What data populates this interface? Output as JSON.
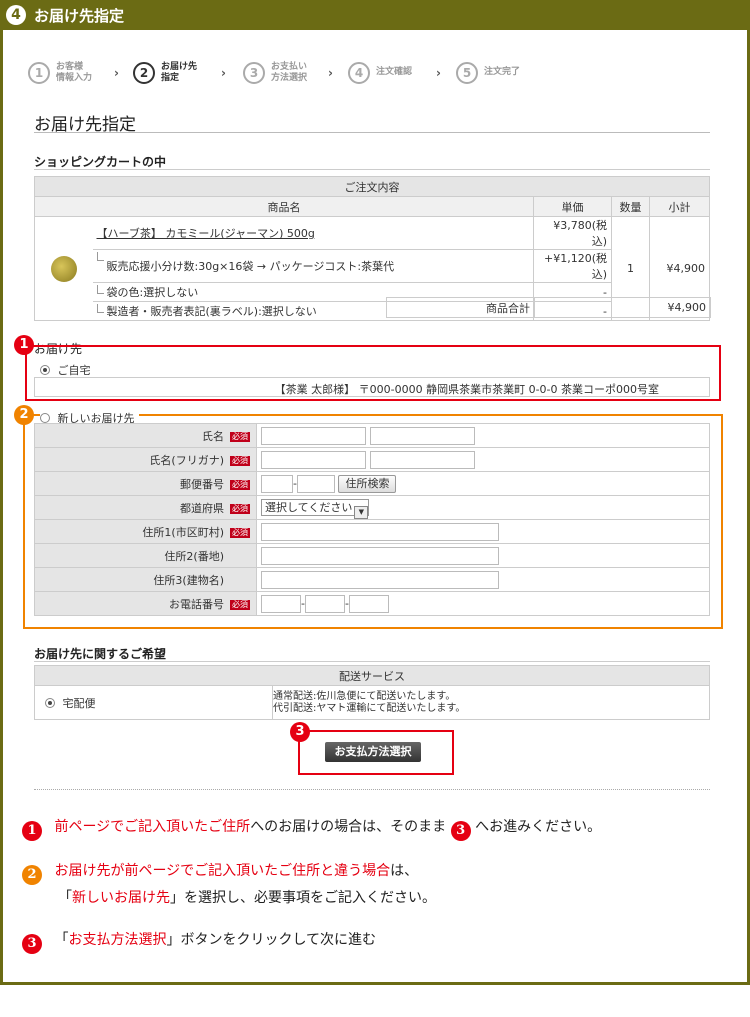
{
  "header": {
    "number": "4",
    "title": "お届け先指定"
  },
  "steps": [
    {
      "num": "1",
      "label1": "お客様",
      "label2": "情報入力"
    },
    {
      "num": "2",
      "label1": "お届け先",
      "label2": "指定"
    },
    {
      "num": "3",
      "label1": "お支払い",
      "label2": "方法選択"
    },
    {
      "num": "4",
      "label1": "注文確認",
      "label2": ""
    },
    {
      "num": "5",
      "label1": "注文完了",
      "label2": ""
    }
  ],
  "step_arrow": "›",
  "page_title": "お届け先指定",
  "cart": {
    "heading": "ショッピングカートの中",
    "table_title": "ご注文内容",
    "col_name": "商品名",
    "col_price": "単価",
    "col_qty": "数量",
    "col_subtotal": "小計",
    "product_name": "【ハーブ茶】 カモミール(ジャーマン) 500g",
    "product_price": "¥3,780(税込)",
    "qty": "1",
    "subtotal": "¥4,900",
    "options": [
      {
        "text": "販売応援小分け数:30g×16袋 → パッケージコスト:茶葉代",
        "price": "+¥1,120(税込)"
      },
      {
        "text": "袋の色:選択しない",
        "price": "-"
      },
      {
        "text": "製造者・販売者表記(裏ラベル):選択しない",
        "price": "-"
      }
    ],
    "total_label": "商品合計",
    "total_value": "¥4,900"
  },
  "delivery_dest": {
    "heading": "お届け先",
    "home_label": "ご自宅",
    "home_address": "【茶業 太郎様】 〒000-0000 静岡県茶業市茶業町 0-0-0 茶業コーポ000号室",
    "new_label": "新しいお届け先"
  },
  "form": {
    "required": "必須",
    "name": "氏名",
    "kana": "氏名(フリガナ)",
    "zip": "郵便番号",
    "zip_sep": "-",
    "zip_search": "住所検索",
    "pref": "都道府県",
    "pref_select": "選択してください",
    "addr1": "住所1(市区町村)",
    "addr2": "住所2(番地)",
    "addr3": "住所3(建物名)",
    "tel": "お電話番号",
    "tel_sep": "-"
  },
  "wishes": {
    "heading": "お届け先に関するご希望",
    "table_title": "配送サービス",
    "option": "宅配便",
    "note1": "通常配送:佐川急便にて配送いたします。",
    "note2": "代引配送:ヤマト運輸にて配送いたします。"
  },
  "submit_label": "お支払方法選択",
  "badges": {
    "one": "1",
    "two": "2",
    "three": "3"
  },
  "notes": {
    "n1_red": "前ページでご記入頂いたご住所",
    "n1_a": "へのお届けの場合は、そのまま",
    "n1_b": "へお進みください。",
    "n2_red": "お届け先が前ページでご記入頂いたご住所と違う場合",
    "n2_a": "は、",
    "n2_l2_a": "「",
    "n2_l2_red": "新しいお届け先",
    "n2_l2_b": "」を選択し、必要事項をご記入ください。",
    "n3_a": "「",
    "n3_red": "お支払方法選択",
    "n3_b": "」ボタンをクリックして次に進む"
  },
  "colors": {
    "header": "#6b6b14",
    "red": "#e50012",
    "orange": "#f08300"
  }
}
